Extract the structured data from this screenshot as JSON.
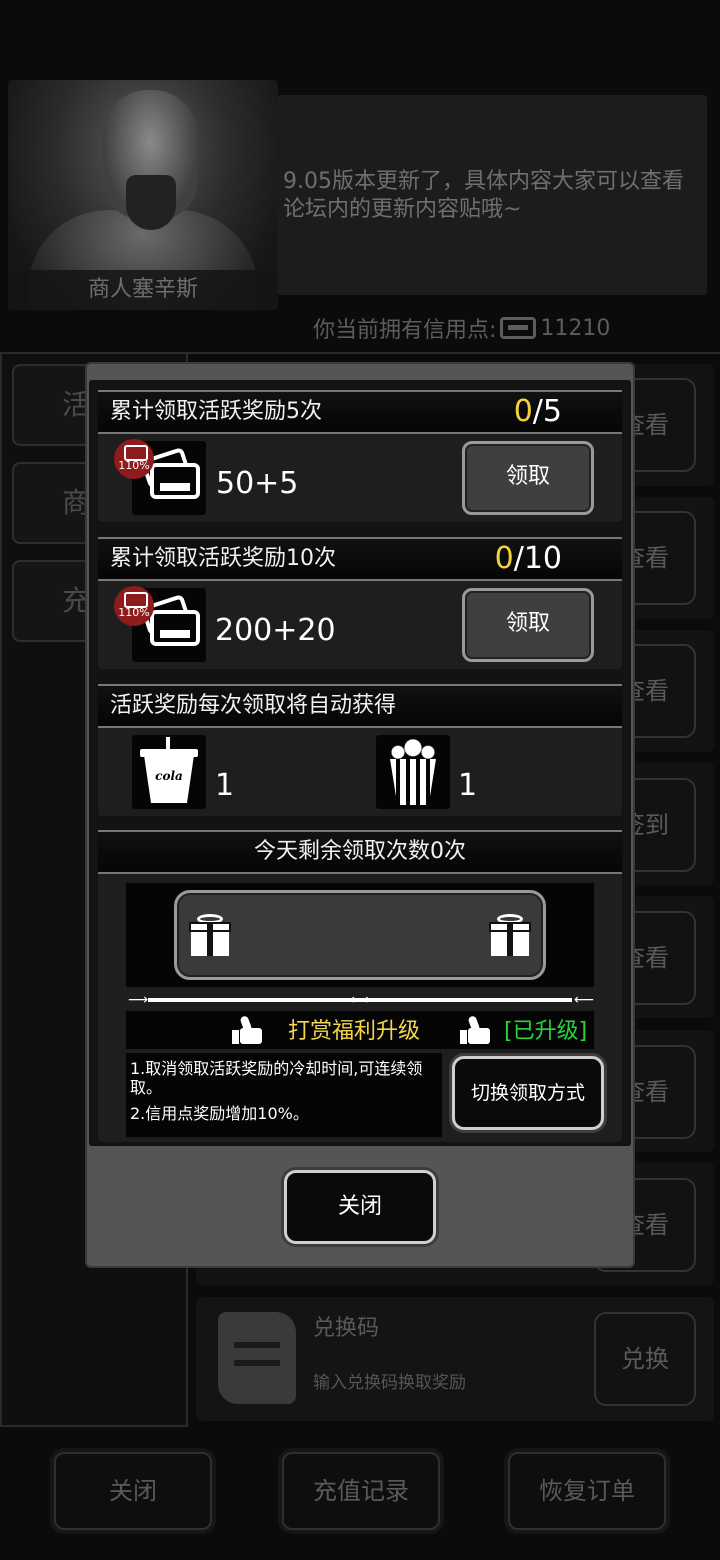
{
  "background": {
    "merchant_name": "商人塞辛斯",
    "announcement": "9.05版本更新了，具体内容大家可以查看论坛内的更新内容贴哦~",
    "credit_label": "你当前拥有信用点:",
    "credit_value": "11210",
    "left_tabs": [
      "活",
      "商",
      "充"
    ],
    "row_buttons": [
      "查看",
      "查看",
      "查看",
      "签到",
      "查看",
      "查看",
      "查看"
    ],
    "redeem": {
      "title": "兑换码",
      "desc": "输入兑换码换取奖励",
      "button": "兑换"
    },
    "bottom_buttons": [
      "关闭",
      "充值记录",
      "恢复订单"
    ]
  },
  "modal": {
    "tier1": {
      "title": "累计领取活跃奖励5次",
      "current": "0",
      "total": "/5",
      "badge": "110%",
      "amount": "50+5",
      "button": "领取"
    },
    "tier2": {
      "title": "累计领取活跃奖励10次",
      "current": "0",
      "total": "/10",
      "badge": "110%",
      "amount": "200+20",
      "button": "领取"
    },
    "auto_rewards": {
      "title": "活跃奖励每次领取将自动获得",
      "items": [
        {
          "icon": "cola-icon",
          "label": "cola",
          "count": "1"
        },
        {
          "icon": "popcorn-icon",
          "count": "1"
        }
      ]
    },
    "remaining": "今天剩余领取次数0次",
    "upgrade": {
      "title": "打赏福利升级",
      "status": "[已升级]",
      "lines": [
        "1.取消领取活跃奖励的冷却时间,可连续领取。",
        "2.信用点奖励增加10%。"
      ],
      "switch_button": "切换领取方式"
    },
    "close_button": "关闭"
  },
  "colors": {
    "highlight_yellow": "#f3d33a",
    "upgraded_green": "#27d63c",
    "badge_red": "#8e1c1c"
  }
}
